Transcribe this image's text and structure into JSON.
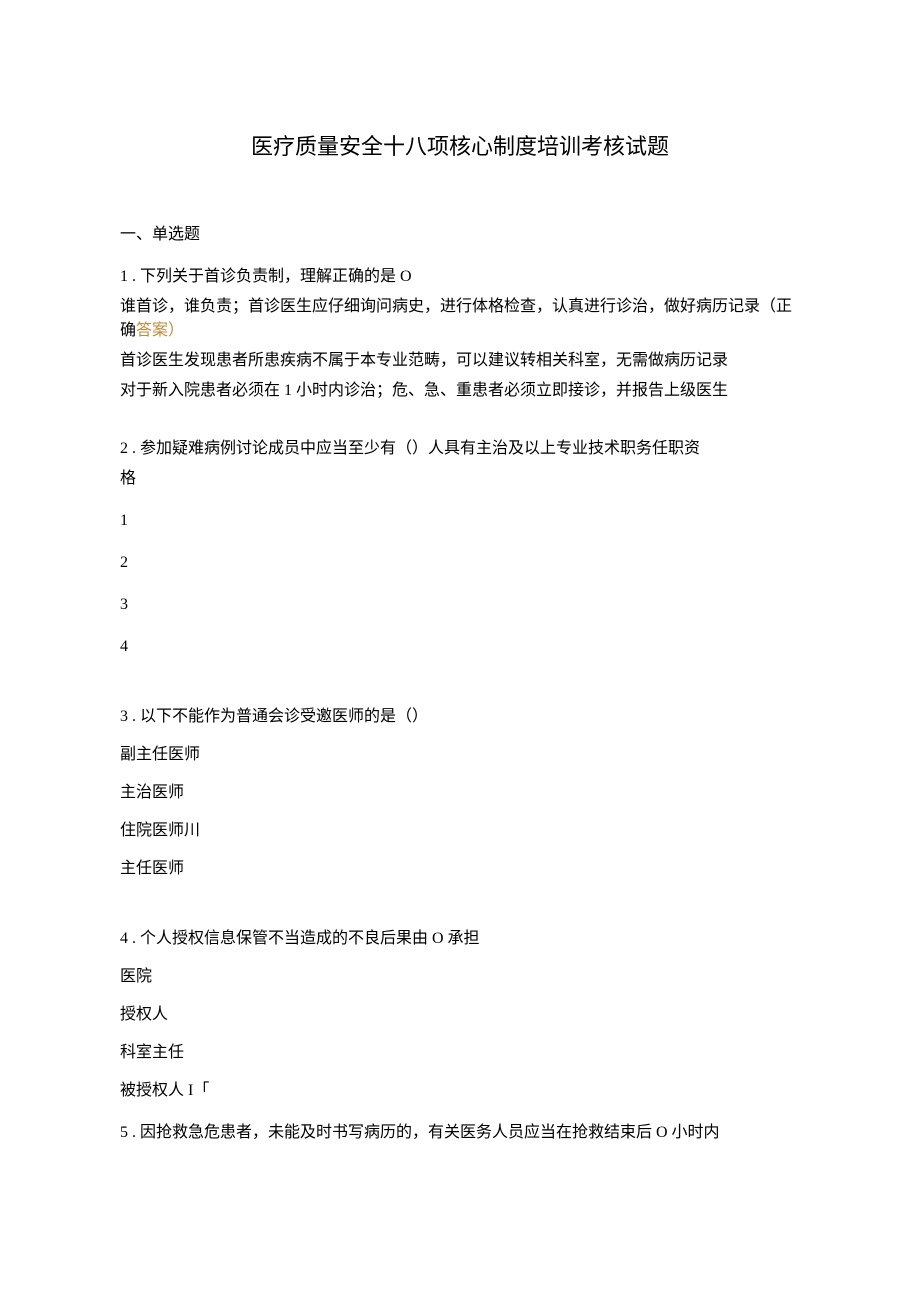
{
  "title": "医疗质量安全十八项核心制度培训考核试题",
  "section1": "一、单选题",
  "q1": {
    "stem": "1 . 下列关于首诊负责制，理解正确的是 O",
    "optA_pre": "谁首诊，谁负责；首诊医生应仔细询问病史，进行体格检查，认真进行诊治，做好病历记录（正确",
    "optA_ans": "答案）",
    "optB": "首诊医生发现患者所患疾病不属于本专业范畴，可以建议转相关科室，无需做病历记录",
    "optC": "对于新入院患者必须在 1 小时内诊治；危、急、重患者必须立即接诊，并报告上级医生"
  },
  "q2": {
    "stem1": "2 . 参加疑难病例讨论成员中应当至少有（）人具有主治及以上专业技术职务任职资",
    "stem2": "格",
    "o1": "1",
    "o2": "2",
    "o3": "3",
    "o4": "4"
  },
  "q3": {
    "stem": "3 . 以下不能作为普通会诊受邀医师的是（）",
    "o1": "副主任医师",
    "o2": "主治医师",
    "o3": "住院医师川",
    "o4": "主任医师"
  },
  "q4": {
    "stem": "4 . 个人授权信息保管不当造成的不良后果由 O 承担",
    "o1": "医院",
    "o2": "授权人",
    "o3": "科室主任",
    "o4": "被授权人 I「"
  },
  "q5": {
    "stem": "5 . 因抢救急危患者，未能及时书写病历的，有关医务人员应当在抢救结束后 O 小时内"
  }
}
